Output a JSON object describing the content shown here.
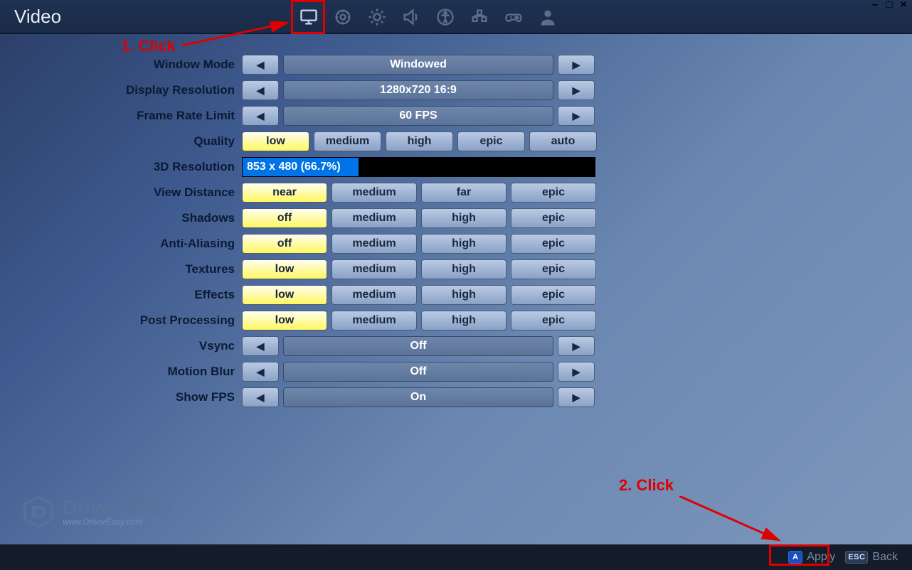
{
  "header": {
    "title": "Video"
  },
  "tabs": {
    "active_index": 0
  },
  "window_controls": {
    "min": "–",
    "max": "□",
    "close": "×"
  },
  "settings": {
    "window_mode": {
      "label": "Window Mode",
      "value": "Windowed"
    },
    "display_resolution": {
      "label": "Display Resolution",
      "value": "1280x720 16:9"
    },
    "frame_rate_limit": {
      "label": "Frame Rate Limit",
      "value": "60 FPS"
    },
    "quality": {
      "label": "Quality",
      "options": [
        "low",
        "medium",
        "high",
        "epic",
        "auto"
      ],
      "selected": "low"
    },
    "res3d": {
      "label": "3D Resolution",
      "text": "853 x 480 (66.7%)",
      "fill_pct": 33
    },
    "view_distance": {
      "label": "View Distance",
      "options": [
        "near",
        "medium",
        "far",
        "epic"
      ],
      "selected": "near"
    },
    "shadows": {
      "label": "Shadows",
      "options": [
        "off",
        "medium",
        "high",
        "epic"
      ],
      "selected": "off"
    },
    "anti_aliasing": {
      "label": "Anti-Aliasing",
      "options": [
        "off",
        "medium",
        "high",
        "epic"
      ],
      "selected": "off"
    },
    "textures": {
      "label": "Textures",
      "options": [
        "low",
        "medium",
        "high",
        "epic"
      ],
      "selected": "low"
    },
    "effects": {
      "label": "Effects",
      "options": [
        "low",
        "medium",
        "high",
        "epic"
      ],
      "selected": "low"
    },
    "post_processing": {
      "label": "Post Processing",
      "options": [
        "low",
        "medium",
        "high",
        "epic"
      ],
      "selected": "low"
    },
    "vsync": {
      "label": "Vsync",
      "value": "Off"
    },
    "motion_blur": {
      "label": "Motion Blur",
      "value": "Off"
    },
    "show_fps": {
      "label": "Show FPS",
      "value": "On"
    }
  },
  "footer": {
    "apply": {
      "key": "A",
      "label": "Apply"
    },
    "back": {
      "key": "ESC",
      "label": "Back"
    }
  },
  "watermark": {
    "brand": "Driver Easy",
    "url": "www.DriverEasy.com"
  },
  "annotations": {
    "step1": "1. Click",
    "step2": "2. Click"
  }
}
